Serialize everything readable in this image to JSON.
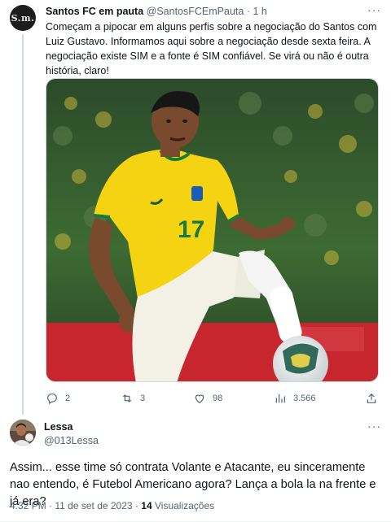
{
  "tweet1": {
    "author_name": "Santos FC em pauta",
    "author_handle": "@SantosFCEmPauta",
    "separator": "·",
    "time": "1 h",
    "avatar_monogram": "S.m.",
    "text": "Começam a pipocar em alguns perfis sobre a negociação do Santos com Luiz Gustavo. Informamos aqui sobre a negociação desde sexta feira. A negociação existe SIM e a fonte é SIM confiável. Se virá ou não é outra história, claro!",
    "media": {
      "jersey_number": "17",
      "jersey_color": "#f4d312",
      "shorts_color": "#f3f1e6",
      "background_color": "#2f5e2c"
    },
    "actions": {
      "replies": "2",
      "retweets": "3",
      "likes": "98",
      "views": "3.566"
    },
    "icons": [
      "reply-icon",
      "retweet-icon",
      "like-icon",
      "views-icon",
      "share-icon",
      "more-icon"
    ]
  },
  "tweet2": {
    "author_name": "Lessa",
    "author_handle": "@013Lessa",
    "text": "Assim... esse time só contrata Volante e Atacante, eu sinceramente nao entendo, é Futebol Americano agora? Lança a bola la na frente e já era?",
    "time": "4:32 PM",
    "date": "11 de set de 2023",
    "views_count": "14",
    "views_label": "Visualizações",
    "separator": "·"
  },
  "colors": {
    "text_primary": "#0f1419",
    "text_secondary": "#536471",
    "border": "#cfd9de"
  }
}
